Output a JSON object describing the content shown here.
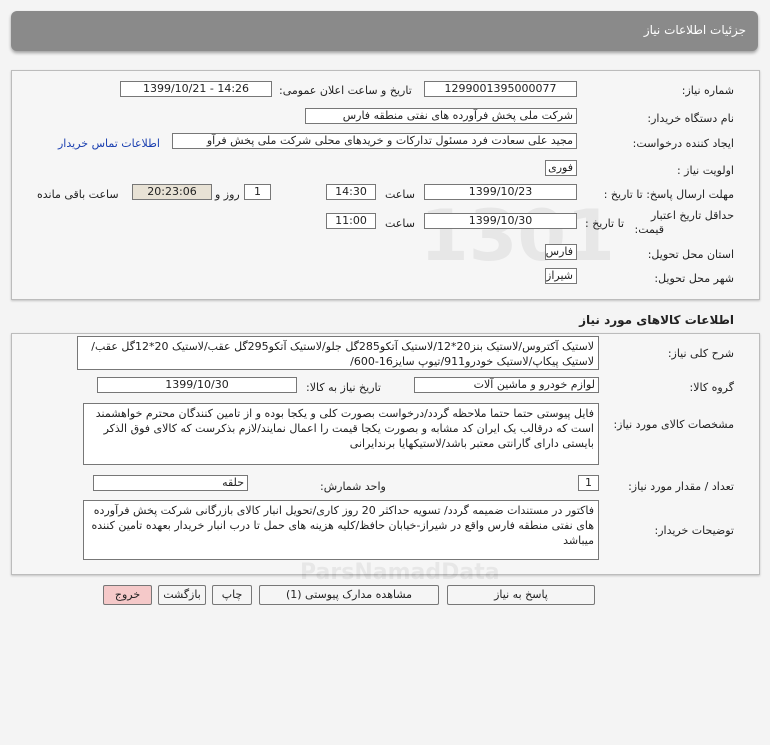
{
  "header": {
    "title": "جزئیات اطلاعات نیاز"
  },
  "form": {
    "need_number": {
      "label": "شماره نیاز:",
      "value": "1299001395000077"
    },
    "announce": {
      "label": "تاریخ و ساعت اعلان عمومی:",
      "value": "1399/10/21 - 14:26"
    },
    "buyer": {
      "label": "نام دستگاه خریدار:",
      "value": "شرکت ملی پخش فرآورده های نفتی منطقه فارس"
    },
    "creator": {
      "label": "ایجاد کننده درخواست:",
      "value": "مجید علی سعادت فرد مسئول تدارکات و خریدهای محلی شرکت ملی پخش فرآو",
      "contact_link": "اطلاعات تماس خریدار"
    },
    "priority": {
      "label": "اولویت نیاز :",
      "value": "فوری"
    },
    "deadline": {
      "label": "مهلت ارسال پاسخ: تا تاریخ :",
      "date": "1399/10/23",
      "time_label": "ساعت",
      "time": "14:30",
      "days": "1",
      "days_label": "روز و",
      "remaining": "20:23:06",
      "remaining_label": "ساعت باقی مانده"
    },
    "validity": {
      "label_line1": "حداقل تاریخ اعتبار",
      "label_line2": "قیمت:",
      "to_date_label": "تا تاریخ :",
      "date": "1399/10/30",
      "time_label": "ساعت",
      "time": "11:00"
    },
    "province": {
      "label": "استان محل تحویل:",
      "value": "فارس"
    },
    "city": {
      "label": "شهر محل تحویل:",
      "value": "شیراز"
    }
  },
  "goods": {
    "section_title": "اطلاعات کالاهای مورد نیاز",
    "summary": {
      "label": "شرح کلی نیاز:",
      "value": "لاستیک آکتروس/لاستیک بنز20*12/لاستیک آتکو285گل جلو/لاستیک آتکو295گل عقب/لاستیک 20*12گل عقب/لاستیک پیکاپ/لاستیک خودرو911/تیوپ سایز16-600/"
    },
    "group": {
      "label": "گروه کالا:",
      "value": "لوازم خودرو و ماشین آلات",
      "need_date_label": "تاریخ نیاز به کالا:",
      "need_date": "1399/10/30"
    },
    "specs": {
      "label": "مشخصات کالای مورد نیاز:",
      "value": "فایل پیوستی حتما حتما ملاحظه گردد/درخواست بصورت کلی و یکجا بوده و از تامین کنندگان محترم خواهشمند است که درقالب یک ایران کد مشابه و بصورت یکجا قیمت را اعمال نمایند/لازم بذکرست که کالای فوق الذکر بایستی دارای گارانتی معتبر باشد/لاستیکهایا برندایرانی"
    },
    "quantity": {
      "label": "تعداد / مقدار مورد نیاز:",
      "value": "1",
      "unit_label": "واحد شمارش:",
      "unit": "حلقه"
    },
    "buyer_notes": {
      "label": "توضیحات خریدار:",
      "value": "فاکتور در مستندات ضمیمه گردد/ تسویه حداکثر 20 روز کاری/تحویل انبار کالای بازرگانی شرکت پخش فرآورده های نفتی منطقه فارس واقع در شیراز-خیابان حافظ/کلیه هزینه های حمل تا درب انبار خریدار بعهده تامین کننده میباشد"
    }
  },
  "buttons": {
    "reply": "پاسخ به نیاز",
    "attachments": "مشاهده مدارک پیوستی (1)",
    "print": "چاپ",
    "back": "بازگشت",
    "exit": "خروج"
  }
}
